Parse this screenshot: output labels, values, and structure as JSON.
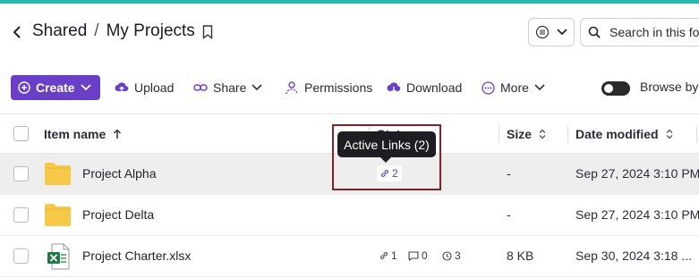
{
  "header": {
    "breadcrumb_parent": "Shared",
    "breadcrumb_separator": "/",
    "breadcrumb_current": "My Projects"
  },
  "search": {
    "placeholder": "Search in this folder",
    "value": ""
  },
  "toolbar": {
    "create_label": "Create",
    "upload_label": "Upload",
    "share_label": "Share",
    "permissions_label": "Permissions",
    "download_label": "Download",
    "more_label": "More",
    "browse_label": "Browse by"
  },
  "table": {
    "columns": {
      "name": "Item name",
      "status": "Status",
      "size": "Size",
      "modified": "Date modified"
    },
    "rows": [
      {
        "name": "Project Alpha",
        "type": "folder",
        "links": "2",
        "size": "-",
        "modified": "Sep 27, 2024 3:10 PM"
      },
      {
        "name": "Project Delta",
        "type": "folder",
        "size": "-",
        "modified": "Sep 27, 2024 3:10 PM"
      },
      {
        "name": "Project Charter.xlsx",
        "type": "xlsx",
        "links": "1",
        "comments": "0",
        "versions": "3",
        "size": "8 KB",
        "modified": "Sep 30, 2024 3:18 ..."
      }
    ]
  },
  "tooltip": {
    "text": "Active Links (2)"
  },
  "colors": {
    "accent": "#6a3fc8",
    "folder": "#f7c948",
    "excel": "#1f7a43",
    "highlight": "#8b1e26",
    "topbar": "#2ab7ad"
  }
}
